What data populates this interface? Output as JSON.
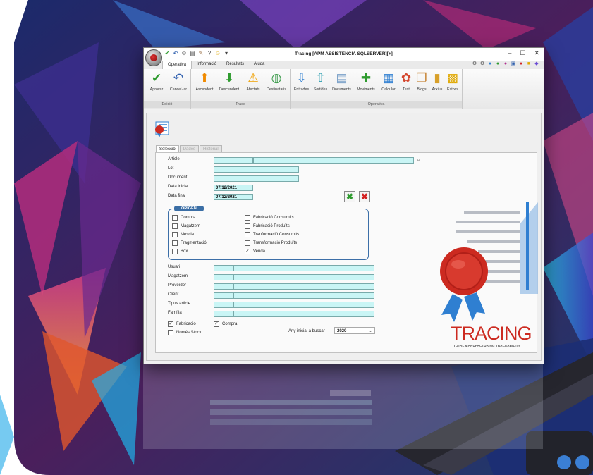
{
  "window": {
    "title": "Tracing [APM ASSISTENCIA SQLSERVER][+]",
    "controls": [
      "–",
      "☐",
      "✕"
    ]
  },
  "menu": {
    "tabs": [
      "Operativa",
      "Informació",
      "Resultats",
      "Ajuda"
    ]
  },
  "ribbon": {
    "groups": [
      {
        "label": "Edició",
        "buttons": [
          {
            "label": "Aprovar",
            "icon": "checkmark-icon"
          },
          {
            "label": "Cancel·lar",
            "icon": "undo-icon"
          }
        ]
      },
      {
        "label": "Trace",
        "buttons": [
          {
            "label": "Ascendent",
            "icon": "arrow-up-icon"
          },
          {
            "label": "Descendent",
            "icon": "arrow-down-icon"
          },
          {
            "label": "Afectats",
            "icon": "warning-icon"
          },
          {
            "label": "Destinataris",
            "icon": "globe-icon"
          }
        ]
      },
      {
        "label": "Operativa",
        "buttons": [
          {
            "label": "Entrades",
            "icon": "entry-icon"
          },
          {
            "label": "Sortides",
            "icon": "exit-icon"
          },
          {
            "label": "Documents",
            "icon": "documents-icon"
          },
          {
            "label": "Moviments",
            "icon": "movements-icon"
          },
          {
            "label": "Calcular",
            "icon": "calculator-icon"
          },
          {
            "label": "Test",
            "icon": "test-icon"
          },
          {
            "label": "Blogs",
            "icon": "blogs-icon"
          },
          {
            "label": "Arxius",
            "icon": "files-icon"
          },
          {
            "label": "Estocs",
            "icon": "stock-icon"
          }
        ]
      }
    ]
  },
  "form": {
    "tabs": [
      "Selecció",
      "Dades",
      "Historial"
    ],
    "fields": {
      "article": {
        "label": "Article",
        "value": ""
      },
      "lot": {
        "label": "Lot",
        "value": ""
      },
      "document": {
        "label": "Document",
        "value": ""
      },
      "data_inicial": {
        "label": "Data inicial",
        "value": "07/12/2021"
      },
      "data_final": {
        "label": "Data final",
        "value": "07/12/2021"
      },
      "usuari": {
        "label": "Usuari",
        "value": ""
      },
      "magatzem": {
        "label": "Magatzem",
        "value": ""
      },
      "proveidor": {
        "label": "Proveïdor",
        "value": ""
      },
      "client": {
        "label": "Client",
        "value": ""
      },
      "tipus_article": {
        "label": "Tipus article",
        "value": ""
      },
      "familia": {
        "label": "Família",
        "value": ""
      }
    },
    "origen": {
      "title": "ORIGEN",
      "left": [
        {
          "label": "Compra",
          "checked": false
        },
        {
          "label": "Magatzem",
          "checked": false
        },
        {
          "label": "Mescla",
          "checked": false
        },
        {
          "label": "Fragmentació",
          "checked": false
        },
        {
          "label": "Box",
          "checked": false
        }
      ],
      "right": [
        {
          "label": "Fabricació Consumits",
          "checked": false
        },
        {
          "label": "Fabricació Produïts",
          "checked": false
        },
        {
          "label": "Tranformació Consumits",
          "checked": false
        },
        {
          "label": "Transformació Produïts",
          "checked": false
        },
        {
          "label": "Venda",
          "checked": true
        }
      ]
    },
    "bottom": {
      "fabricacio": {
        "label": "Fabricació",
        "checked": true
      },
      "compra": {
        "label": "Compra",
        "checked": true
      },
      "nomes_stock": {
        "label": "Només Stock",
        "checked": false
      },
      "any_label": "Any inicial a buscar",
      "any_value": "2020"
    }
  },
  "brand": {
    "name": "TRACING",
    "tagline": "TOTAL MANUFACTURING TRACEABILITY",
    "red": "#cc2a20",
    "blue": "#2f7fd1"
  },
  "colors": {
    "field": "#c9f5f5",
    "origen_border": "#3c6fa8",
    "ok": "#2e9b2e",
    "cancel": "#d42323"
  }
}
